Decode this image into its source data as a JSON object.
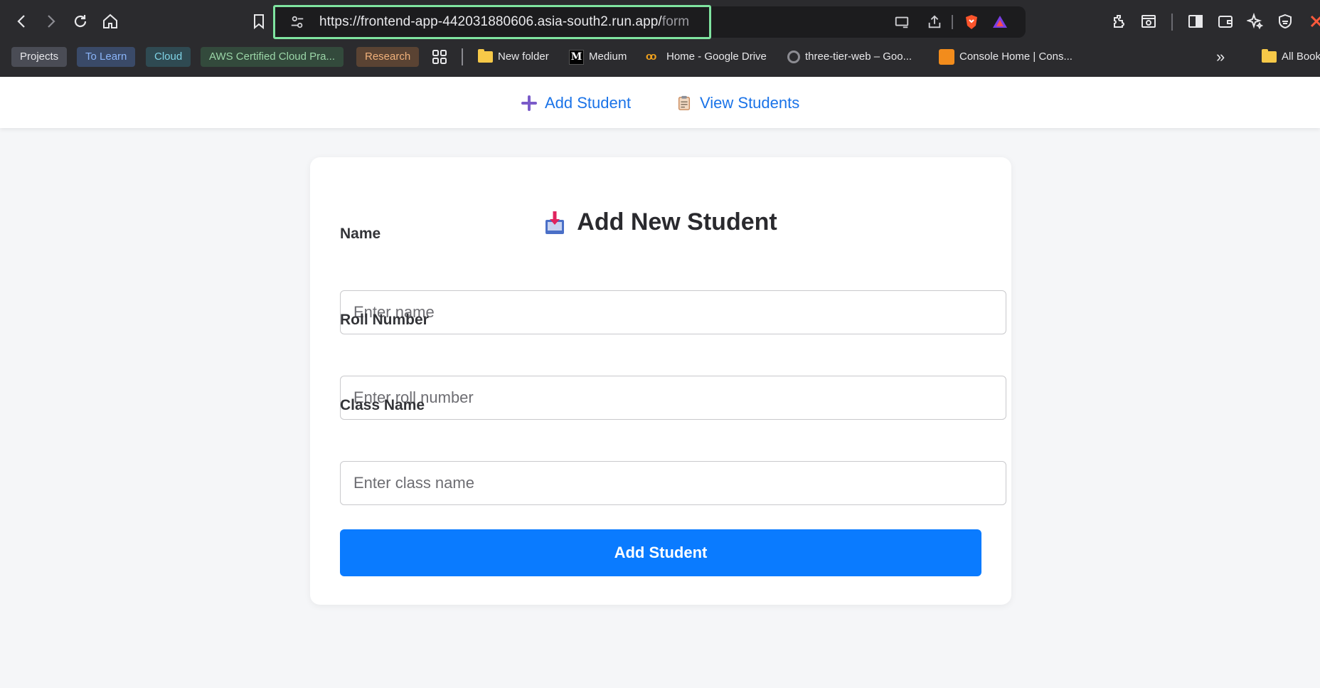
{
  "browser": {
    "url_host": "https://frontend-app-442031880606.asia-south2.run.app/",
    "url_path": "form",
    "bookmark_chips": [
      {
        "label": "Projects",
        "bg": "#4a4c55",
        "fg": "#e6e6ea"
      },
      {
        "label": "To Learn",
        "bg": "#3a4a68",
        "fg": "#8ab4f8"
      },
      {
        "label": "Cloud",
        "bg": "#2f4a52",
        "fg": "#7fd3e6"
      },
      {
        "label": "AWS Certified Cloud Pra...",
        "bg": "#334a3c",
        "fg": "#9bd6a8"
      },
      {
        "label": "Research",
        "bg": "#5a4333",
        "fg": "#f0b07a"
      }
    ],
    "bookmarks": [
      {
        "label": "New folder",
        "icon": "folder-icon"
      },
      {
        "label": "Medium",
        "icon": "medium-logo"
      },
      {
        "label": "Home - Google Drive",
        "icon": "drive-logo"
      },
      {
        "label": "three-tier-web – Goo...",
        "icon": "github-logo"
      },
      {
        "label": "Console Home | Cons...",
        "icon": "aws-logo"
      }
    ],
    "overflow_label": "»",
    "all_bookmarks_label": "All Book"
  },
  "nav": {
    "add_student": "Add Student",
    "view_students": "View Students",
    "accent": "#1a73e8"
  },
  "form": {
    "title": "Add New Student",
    "name_label": "Name",
    "name_placeholder": "Enter name",
    "roll_label": "Roll Number",
    "roll_placeholder": "Enter roll number",
    "class_label": "Class Name",
    "class_placeholder": "Enter class name",
    "submit_label": "Add Student",
    "button_color": "#0a7bff"
  }
}
